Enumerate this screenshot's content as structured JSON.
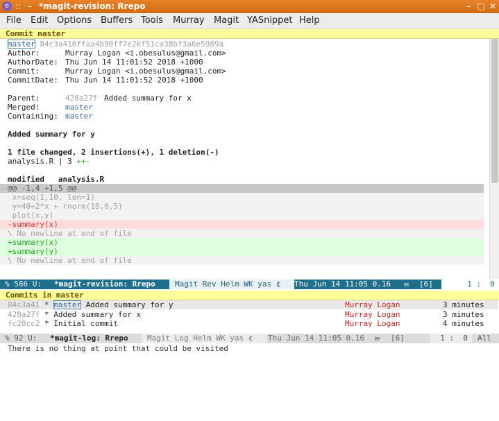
{
  "window": {
    "title": "*magit-revision: Rrepo",
    "title_prefix": "::",
    "dash": "–",
    "buttons": [
      "–",
      "□",
      "✕"
    ]
  },
  "menu": [
    "File",
    "Edit",
    "Options",
    "Buffers",
    "Tools",
    "Murray",
    "Magit",
    "YASnippet",
    "Help"
  ],
  "revision": {
    "header": "Commit master",
    "ref": "master",
    "hash": "84c3a416ffaa4b90ff7e26f51ca38bf3a6e5989a",
    "author_label": "Author:",
    "author": "Murray Logan <i.obesulus@gmail.com>",
    "author_date_label": "AuthorDate:",
    "author_date": "Thu Jun 14 11:01:52 2018 +1000",
    "commit_label": "Commit:",
    "committer": "Murray Logan <i.obesulus@gmail.com>",
    "commit_date_label": "CommitDate:",
    "commit_date": "Thu Jun 14 11:01:52 2018 +1000",
    "parent_label": "Parent:",
    "parent_hash": "428a27f",
    "parent_msg": "Added summary for x",
    "merged_label": "Merged:",
    "merged": "master",
    "containing_label": "Containing:",
    "containing": "master",
    "summary": "Added summary for y",
    "stats": "1 file changed, 2 insertions(+), 1 deletion(-)",
    "file_stat_name": "analysis.R | 3 ",
    "file_stat_marks": "++-",
    "modified": "modified   analysis.R",
    "hunk": "@@ -1,4 +1,5 @@",
    "ctx1": " x=seq(1,10, len=1)",
    "ctx2": " y=40+2*x + rnorm(10,0,5)",
    "ctx3": " plot(x,y)",
    "del1": "-summary(x)",
    "nonl1": "\\ No newline at end of file",
    "add1": "+summary(x)",
    "add2": "+summary(y)",
    "nonl2": "\\ No newline at end of file"
  },
  "modeline_top": {
    "left": "% 586 U:",
    "buffer": "*magit-revision: Rrepo",
    "modes": "Magit Rev Helm WK yas ¢",
    "time": "Thu Jun 14 11:05 0.16",
    "mail": "✉",
    "count": "[6]",
    "pos": "1 :  0"
  },
  "log": {
    "header": "Commits in master",
    "rows": [
      {
        "hash": "84c3a41",
        "star": "*",
        "ref": "master",
        "msg": "Added summary for y",
        "author": "Murray Logan",
        "age": "3 minutes"
      },
      {
        "hash": "428a27f",
        "star": "*",
        "ref": "",
        "msg": "Added summary for x",
        "author": "Murray Logan",
        "age": "3 minutes"
      },
      {
        "hash": "fc20cc2",
        "star": "*",
        "ref": "",
        "msg": "Initial commit",
        "author": "Murray Logan",
        "age": "4 minutes"
      }
    ]
  },
  "modeline_bottom": {
    "left": "% 92 U:",
    "buffer": "*magit-log: Rrepo",
    "modes": "Magit Log Helm WK yas ¢",
    "time": "Thu Jun 14 11:05 0.16",
    "mail": "✉",
    "count": "[6]",
    "pos": "1 :  0",
    "all": "All"
  },
  "echo": "There is no thing at point that could be visited",
  "colors": {
    "title_bar": "#e07a20",
    "header_yellow": "#ffff9a",
    "modeline_active": "#1f6e8a",
    "modeline_inactive": "#d8d8d8",
    "diff_removed": "#ffdddd",
    "diff_added": "#ddffdd",
    "hunk_header": "#c8c8c8"
  }
}
